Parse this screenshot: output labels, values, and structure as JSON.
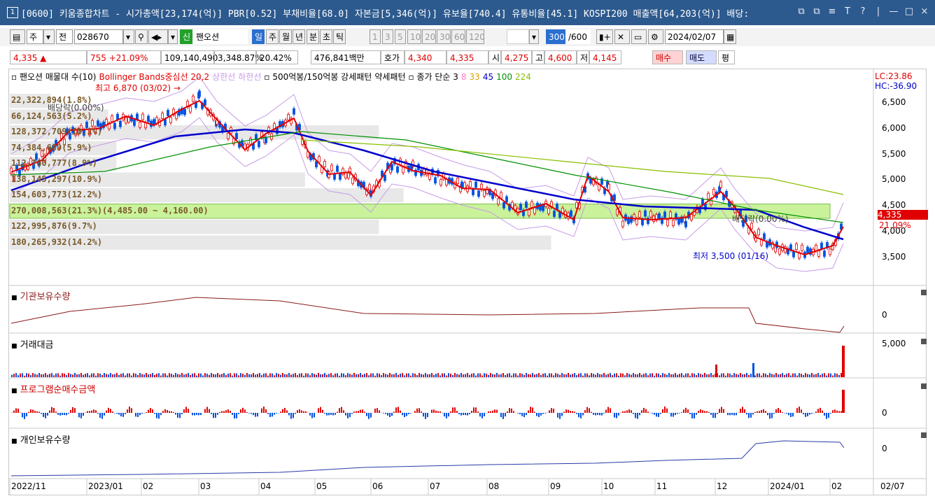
{
  "window": {
    "num": "1",
    "title": "[0600] 키움종합차트 - 시가총액[23,174(억)] PBR[0.52] 부채비율[68.0] 자본금[5,346(억)] 유보율[740.4] 유통비율[45.1] KOSPI200 매출액[64,203(억)] 배당:",
    "btns": [
      "⧉",
      "⧉",
      "≡",
      "T",
      "?",
      "|",
      "—",
      "□",
      "×"
    ]
  },
  "toolbar1": {
    "period_main": "주",
    "jeon": "전",
    "code": "028670",
    "new_badge": "신",
    "name": "팬오션",
    "periods": [
      "일",
      "주",
      "월",
      "년",
      "분",
      "초",
      "틱"
    ],
    "nums": [
      "1",
      "3",
      "5",
      "10",
      "20",
      "30",
      "60",
      "120"
    ],
    "count": "300",
    "max": "/600",
    "date": "2024/02/07"
  },
  "quote": {
    "price": "4,335 ▲",
    "change": "755 +21.09%",
    "volume": "109,140,490",
    "vol_ratio": "3,348.87%",
    "turnover": "20.42%",
    "amount": "476,841백만",
    "hoga_label": "호가",
    "hoga1": "4,340",
    "hoga2": "4,335",
    "open_label": "시",
    "open": "4,275",
    "high_label": "고",
    "high": "4,600",
    "low_label": "저",
    "low": "4,145",
    "buy": "매수",
    "sell": "매도",
    "avg": "평"
  },
  "legend": {
    "items": [
      {
        "text": "팬오션 매물대 수(10)",
        "color": "#000000"
      },
      {
        "text": "Bollinger Bands중심선 20,2",
        "color": "#e00000"
      },
      {
        "text": "상한선",
        "color": "#c79be6"
      },
      {
        "text": "하한선",
        "color": "#c79be6"
      },
      {
        "text": "500억봉/150억봉 강세패턴",
        "color": "#000000"
      },
      {
        "text": "약세패턴",
        "color": "#000000"
      },
      {
        "text": "종가 단순 3",
        "color": "#000000"
      },
      {
        "text": "8",
        "color": "#ff80c0"
      },
      {
        "text": "33",
        "color": "#e0a000"
      },
      {
        "text": "45",
        "color": "#0000cc"
      },
      {
        "text": "100",
        "color": "#009000"
      },
      {
        "text": "224",
        "color": "#88c000"
      }
    ]
  },
  "lc_hc": {
    "lc": "LC:23.86",
    "hc": "HC:-36.90"
  },
  "annotations": {
    "high": "최고 6,870 (03/02) →",
    "low": "최저 3,500 (01/16)",
    "div1": "배당락(0.00%)",
    "div2": "배당락(0.00%)"
  },
  "volume_profile": [
    {
      "label": "22,322,894(1.8%)",
      "w": 0.05
    },
    {
      "label": "66,124,563(5.2%)",
      "w": 0.12
    },
    {
      "label": "128,372,709(10.1%)",
      "w": 0.45
    },
    {
      "label": "74,384,689(5.9%)",
      "w": 0.13
    },
    {
      "label": "112,760,777(8.9%)",
      "w": 0.13
    },
    {
      "label": "138,145,297(10.9%)",
      "w": 0.36
    },
    {
      "label": "154,603,773(12.2%)",
      "w": 0.48
    },
    {
      "label": "270,008,563(21.3%)(4,485.00 ~ 4,160.00)",
      "w": 1.0
    },
    {
      "label": "122,995,876(9.7%)",
      "w": 0.45
    },
    {
      "label": "180,265,932(14.2%)",
      "w": 0.66
    }
  ],
  "price_axis": {
    "ticks": [
      "6,500",
      "6,000",
      "5,500",
      "5,000",
      "4,500",
      "4,000",
      "3,500"
    ],
    "current_price": "4,335",
    "current_change": "21.09%"
  },
  "panels": [
    {
      "label": "기관보유수량",
      "color": "#8b1a1a",
      "tick": "0"
    },
    {
      "label": "거래대금",
      "color": "#000000",
      "tick": "5,000"
    },
    {
      "label": "프로그램순매수금액",
      "color": "#cc0000",
      "tick": "0"
    },
    {
      "label": "개인보유수량",
      "color": "#000000",
      "tick": "0"
    }
  ],
  "x_axis": [
    "2022/11",
    "2023/01",
    "02",
    "03",
    "04",
    "05",
    "06",
    "07",
    "08",
    "09",
    "10",
    "11",
    "12",
    "2024/01",
    "02"
  ],
  "x_right": "02/07",
  "colors": {
    "up": "#e00000",
    "down": "#0050e0",
    "ma_blue": "#0000cc",
    "ma_green": "#009000",
    "ma_yellow": "#88c000",
    "bb": "#c79be6",
    "vp_hi": "#c9f29b",
    "vp": "#e8e8e8"
  }
}
